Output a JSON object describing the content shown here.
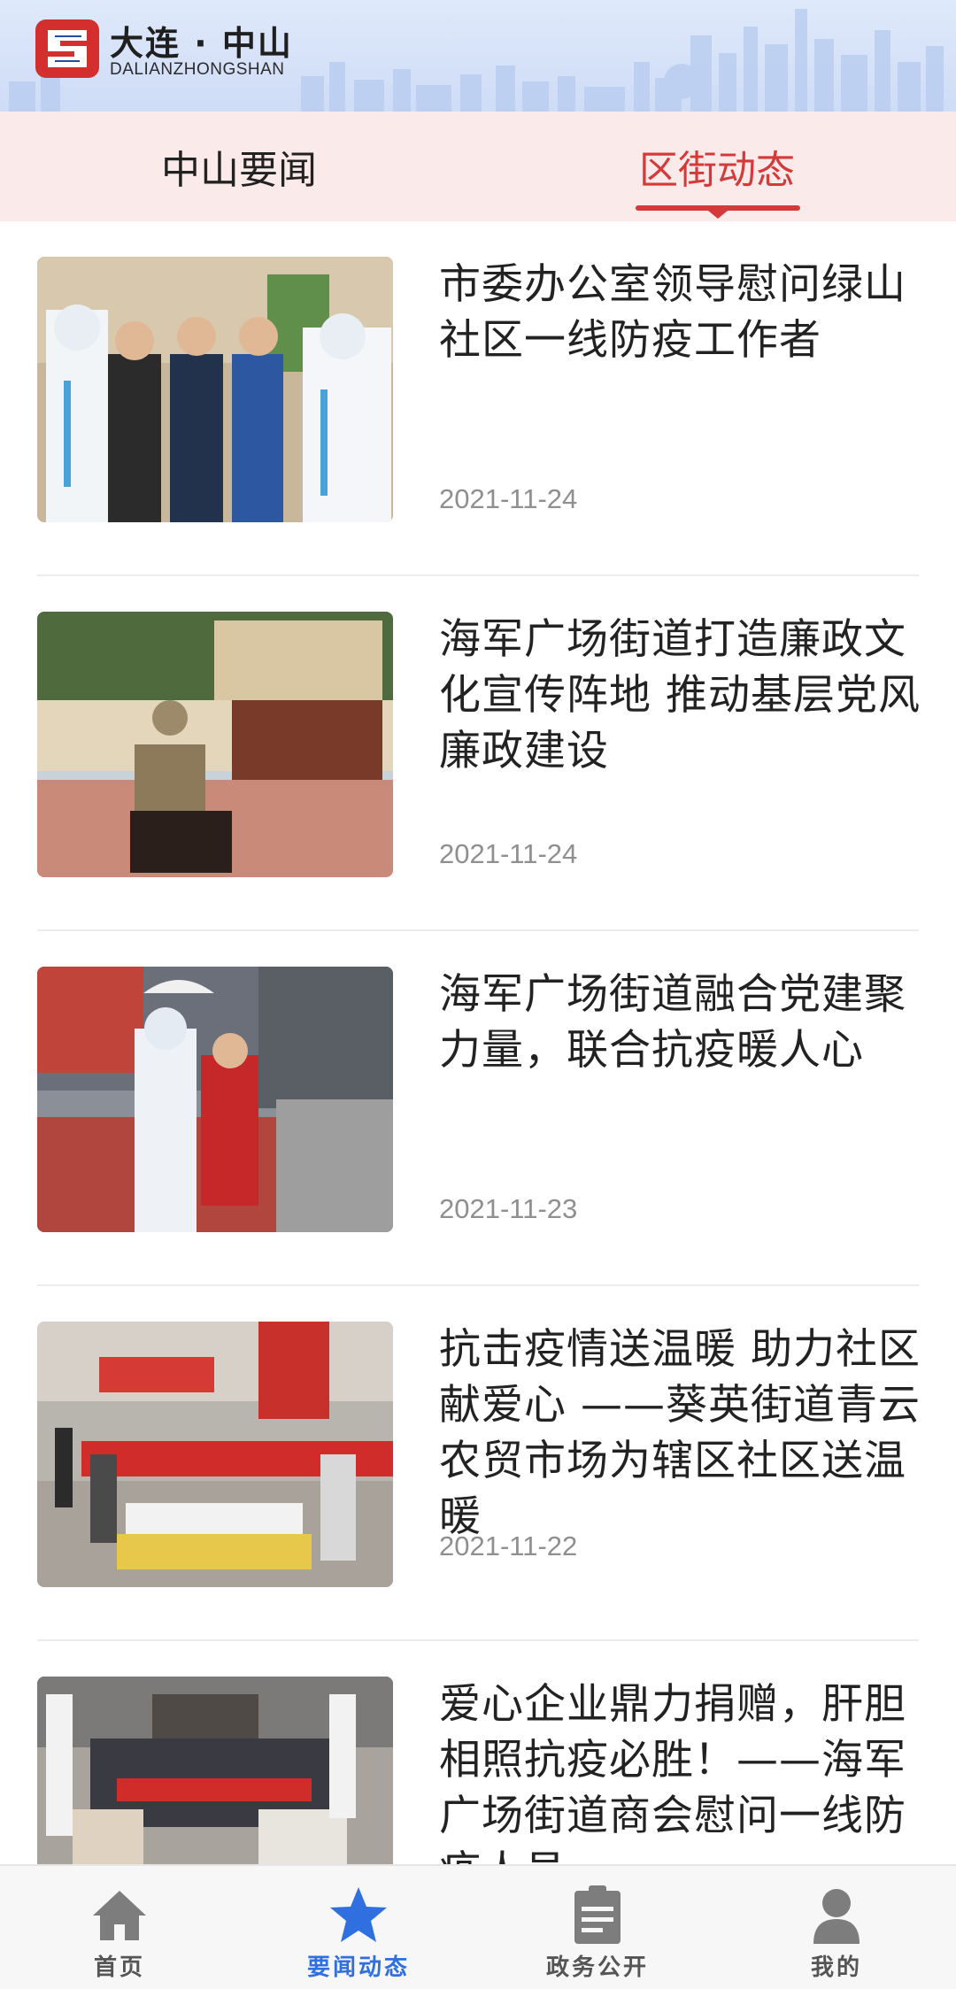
{
  "header": {
    "brand_cn": "大连 · 中山",
    "brand_en": "DALIANZHONGSHAN",
    "logo_icon": "dalian-zhongshan-logo"
  },
  "tabs": [
    {
      "label": "中山要闻",
      "active": false
    },
    {
      "label": "区街动态",
      "active": true
    }
  ],
  "accent_color": "#d43a3a",
  "nav_active_color": "#2f6fe0",
  "news": [
    {
      "title": "市委办公室领导慰问绿山社区一线防疫工作者",
      "date": "2021-11-24",
      "image": "photo-officials-with-medical-staff"
    },
    {
      "title": "海军广场街道打造廉政文化宣传阵地 推动基层党风廉政建设",
      "date": "2021-11-24",
      "image": "photo-statue-plaza"
    },
    {
      "title": "海军广场街道融合党建聚力量，联合抗疫暖人心",
      "date": "2021-11-23",
      "image": "photo-testing-worker-street"
    },
    {
      "title": "抗击疫情送温暖 助力社区献爱心 ——葵英街道青云农贸市场为辖区社区送温暖",
      "date": "2021-11-22",
      "image": "photo-market-donation"
    },
    {
      "title": "爱心企业鼎力捐赠，肝胆相照抗疫必胜！——海军广场街道商会慰问一线防疫人员",
      "date": "",
      "image": "photo-group-donation-banner"
    }
  ],
  "bottom_nav": [
    {
      "label": "首页",
      "icon": "home-icon",
      "active": false
    },
    {
      "label": "要闻动态",
      "icon": "star-icon",
      "active": true
    },
    {
      "label": "政务公开",
      "icon": "clipboard-icon",
      "active": false
    },
    {
      "label": "我的",
      "icon": "user-icon",
      "active": false
    }
  ]
}
